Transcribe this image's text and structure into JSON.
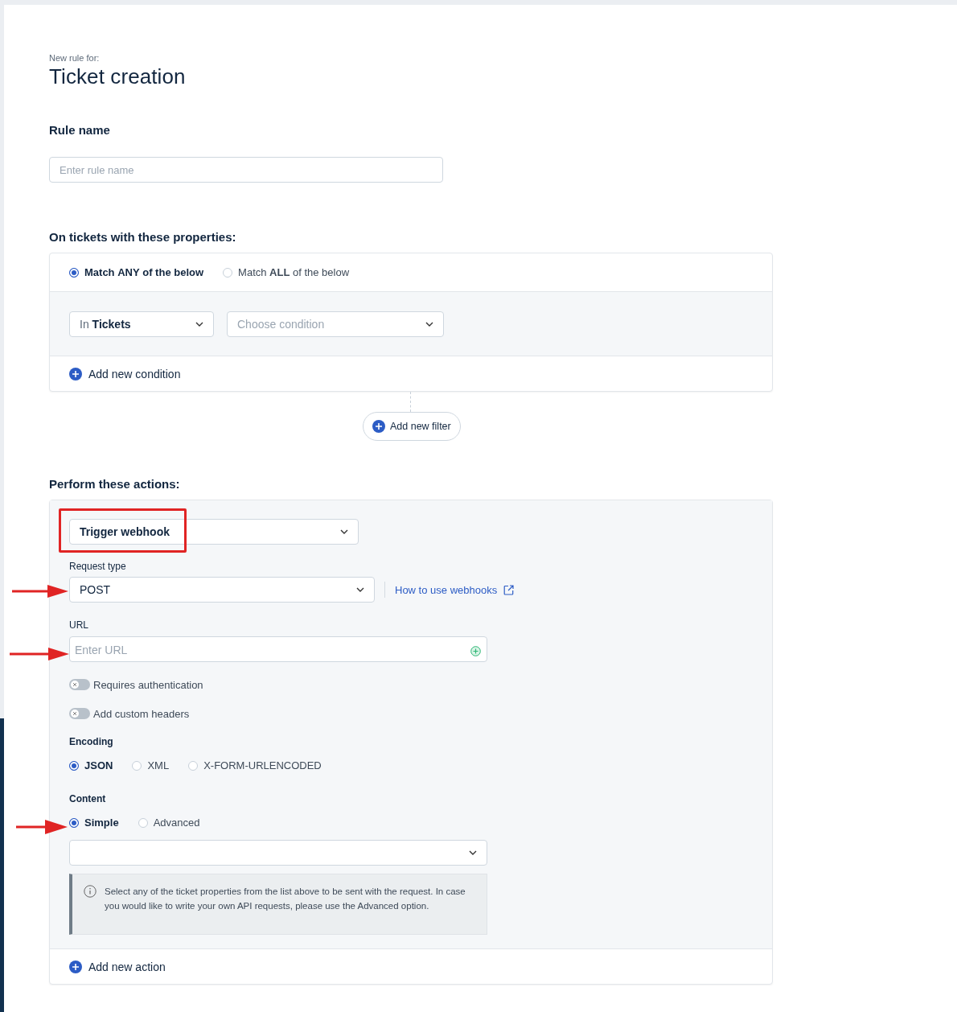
{
  "header": {
    "subtitle": "New rule for:",
    "title": "Ticket creation"
  },
  "rule_name": {
    "label": "Rule name",
    "placeholder": "Enter rule name"
  },
  "conditions": {
    "heading": "On tickets with these properties:",
    "match_options": [
      {
        "label": "Match **ANY** of the below",
        "selected": true
      },
      {
        "label": "Match **ALL** of the below",
        "selected": false
      }
    ],
    "scope_select": {
      "value": "In **Tickets**"
    },
    "condition_select": {
      "placeholder": "Choose condition"
    },
    "add_condition": "Add new condition"
  },
  "add_filter": "Add new filter",
  "actions": {
    "heading": "Perform these actions:",
    "action_select": {
      "value": "Trigger webhook"
    },
    "request_type": {
      "label": "Request type",
      "value": "POST"
    },
    "help_link": "How to use webhooks",
    "url": {
      "label": "URL",
      "placeholder": "Enter URL"
    },
    "toggles": [
      {
        "label": "Requires authentication",
        "on": false
      },
      {
        "label": "Add custom headers",
        "on": false
      }
    ],
    "encoding": {
      "label": "Encoding",
      "options": [
        {
          "label": "JSON",
          "selected": true
        },
        {
          "label": "XML",
          "selected": false
        },
        {
          "label": "X-FORM-URLENCODED",
          "selected": false
        }
      ]
    },
    "content": {
      "label": "Content",
      "options": [
        {
          "label": "Simple",
          "selected": true
        },
        {
          "label": "Advanced",
          "selected": false
        }
      ]
    },
    "info": "Select any of the ticket properties from the list above to be sent with the request. In case you would like to write your own API requests, please use the Advanced option.",
    "add_action": "Add new action"
  }
}
